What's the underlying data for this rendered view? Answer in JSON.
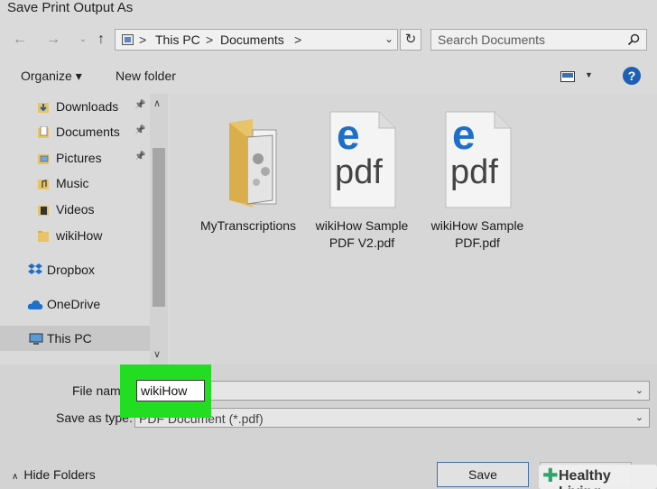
{
  "window": {
    "title": "Save Print Output As"
  },
  "nav": {
    "back": "←",
    "forward": "→",
    "recent": "⌄",
    "up": "↑",
    "refresh": "↻"
  },
  "address": {
    "crumbs": [
      "This PC",
      "Documents"
    ],
    "separator": ">",
    "dropdown": "⌄"
  },
  "search": {
    "placeholder": "Search Documents"
  },
  "toolbar": {
    "organize": "Organize ▾",
    "new_folder": "New folder",
    "view_caret": "▼",
    "help": "?"
  },
  "sidebar": {
    "items": [
      {
        "label": "Downloads",
        "icon": "download-folder-icon",
        "pinned": true
      },
      {
        "label": "Documents",
        "icon": "documents-folder-icon",
        "pinned": true
      },
      {
        "label": "Pictures",
        "icon": "pictures-folder-icon",
        "pinned": true
      },
      {
        "label": "Music",
        "icon": "music-folder-icon",
        "pinned": false
      },
      {
        "label": "Videos",
        "icon": "videos-folder-icon",
        "pinned": false
      },
      {
        "label": "wikiHow",
        "icon": "folder-icon",
        "pinned": false
      },
      {
        "label": "Dropbox",
        "icon": "dropbox-icon",
        "pinned": false
      },
      {
        "label": "OneDrive",
        "icon": "onedrive-icon",
        "pinned": false
      },
      {
        "label": "This PC",
        "icon": "this-pc-icon",
        "pinned": false,
        "selected": true
      }
    ],
    "pin_glyph": "📌",
    "scroll_up": "∧",
    "scroll_down": "∨"
  },
  "files": [
    {
      "name": "MyTranscriptions",
      "type": "folder"
    },
    {
      "name": "wikiHow Sample PDF V2.pdf",
      "line1": "wikiHow Sample",
      "line2": "PDF V2.pdf",
      "type": "pdf"
    },
    {
      "name": "wikiHow Sample PDF.pdf",
      "line1": "wikiHow Sample",
      "line2": "PDF.pdf",
      "type": "pdf"
    }
  ],
  "pdf_badge": {
    "letter": "e",
    "text": "pdf"
  },
  "form": {
    "filename_label": "File nam",
    "filename_value": "wikiHow",
    "savetype_label": "Save as type:",
    "savetype_value": "PDF Document (*.pdf)",
    "caret": "⌄"
  },
  "footer": {
    "hide_folders": "Hide Folders",
    "hide_chevron": "∧",
    "save": "Save"
  },
  "watermark": {
    "plus": "✚",
    "text": "Healthy Living"
  },
  "colors": {
    "highlight": "#22dd22",
    "edge_blue": "#1f6fc9",
    "folder_yellow": "#e8c468",
    "help_blue": "#1c5fb5"
  }
}
